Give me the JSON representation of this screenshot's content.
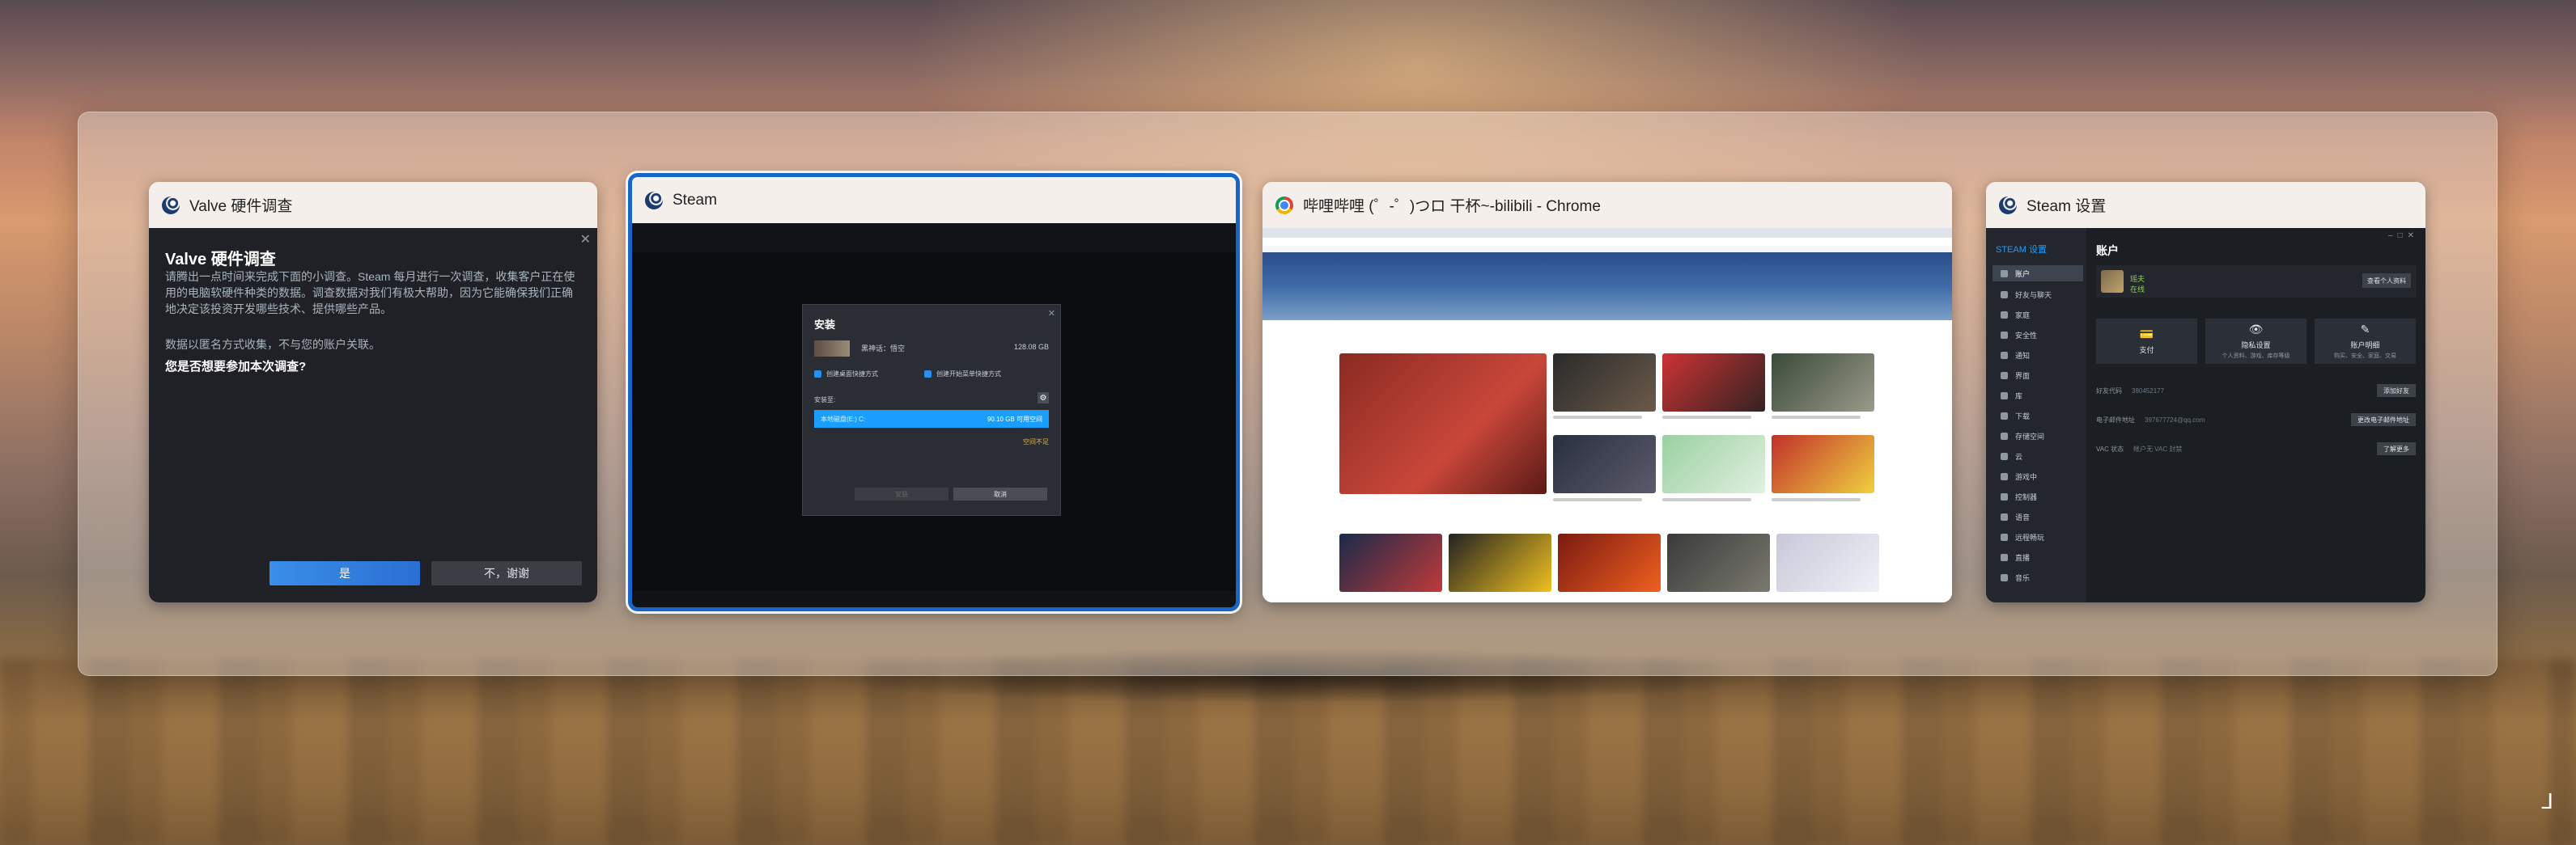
{
  "windows": [
    {
      "title": "Valve 硬件调查",
      "survey": {
        "heading": "Valve 硬件调查",
        "body": "请腾出一点时间来完成下面的小调查。Steam 每月进行一次调查，收集客户正在使用的电脑软硬件种类的数据。调查数据对我们有极大帮助，因为它能确保我们正确地决定该投资开发哪些技术、提供哪些产品。",
        "anonymous": "数据以匿名方式收集，不与您的账户关联。",
        "question": "您是否想要参加本次调查?",
        "yes_label": "是",
        "no_label": "不，谢谢"
      }
    },
    {
      "title": "Steam",
      "install_dialog": {
        "title": "安装",
        "game_name": "黑神话：悟空",
        "game_size": "128.08 GB",
        "checkbox_1": "创建桌面快捷方式",
        "checkbox_2": "创建开始菜单快捷方式",
        "location_label": "安装至:",
        "drive_label": "本地磁盘(E:) C:",
        "drive_free": "90.10 GB 可用空间",
        "warning": "空间不足",
        "install_label": "安装",
        "cancel_label": "取消"
      }
    },
    {
      "title": "哔哩哔哩 (゜-゜)つロ 干杯~-bilibili - Chrome"
    },
    {
      "title": "Steam 设置",
      "settings": {
        "sidebar_title": "STEAM 设置",
        "sidebar_items": [
          "账户",
          "好友与聊天",
          "家庭",
          "安全性",
          "通知",
          "界面",
          "库",
          "下载",
          "存储空间",
          "云",
          "游戏中",
          "控制器",
          "语音",
          "远程畅玩",
          "直播",
          "音乐"
        ],
        "section_title": "账户",
        "profile_name": "瑶夫",
        "profile_status": "在线",
        "view_profile": "查看个人资料",
        "tiles": [
          {
            "icon": "💳",
            "label": "支付",
            "sub": ""
          },
          {
            "icon": "👁",
            "label": "隐私设置",
            "sub": "个人资料、游戏、库存等级"
          },
          {
            "icon": "✎",
            "label": "账户明细",
            "sub": "购买、安全、家庭、交易"
          }
        ],
        "rows": [
          {
            "label": "好友代码",
            "value": "380452177",
            "button": "添加好友"
          },
          {
            "label": "电子邮件地址",
            "value": "397677724@qq.com",
            "button": "更改电子邮件地址"
          },
          {
            "label": "VAC 状态",
            "value": "帐户无 VAC 封禁",
            "button": "了解更多"
          }
        ]
      }
    }
  ],
  "corner_glyph": "⅃"
}
